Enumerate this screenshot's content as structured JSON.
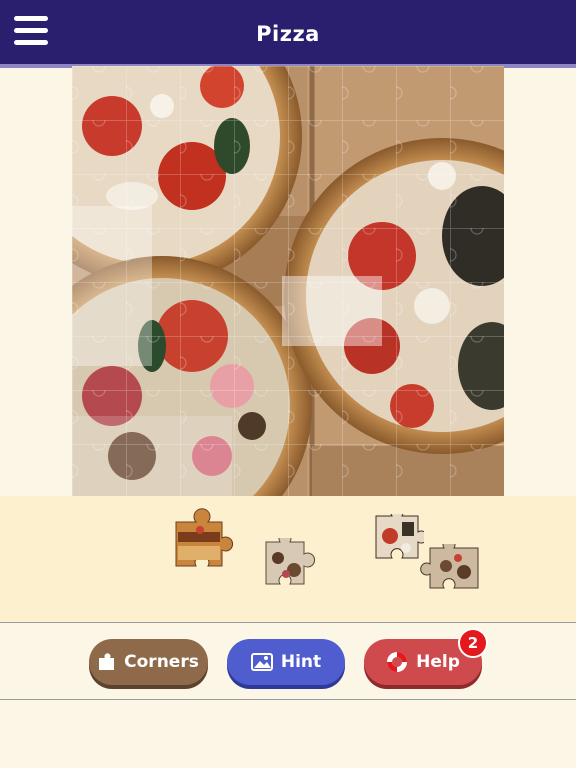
{
  "header": {
    "title": "Pizza"
  },
  "buttons": {
    "corners_label": "Corners",
    "hint_label": "Hint",
    "help_label": "Help",
    "help_badge": "2"
  },
  "colors": {
    "header_bg": "#2a1e6e",
    "tray_bg": "#fdf0cf",
    "corners_btn": "#8f6a4a",
    "hint_btn": "#4f5dcf",
    "help_btn": "#cf4a4c",
    "badge": "#e3191e"
  },
  "puzzle": {
    "image_subject": "two pizzas in cardboard boxes",
    "pieces_remaining_in_tray": 4
  },
  "icons": {
    "menu": "hamburger-icon",
    "corners": "puzzle-corner-icon",
    "hint": "image-icon",
    "help": "lifebuoy-icon"
  }
}
